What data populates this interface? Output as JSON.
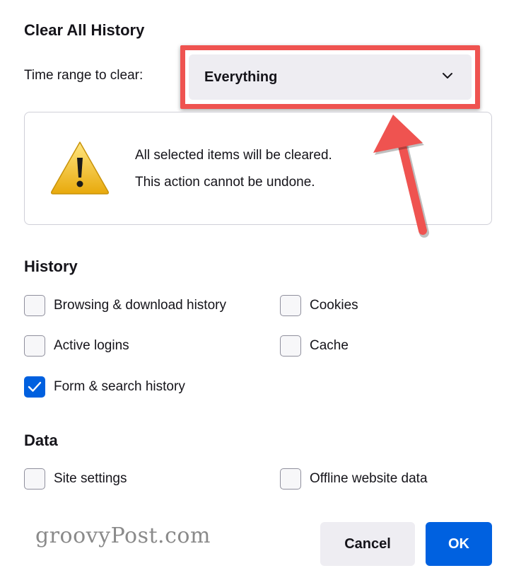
{
  "dialog": {
    "title": "Clear All History",
    "time_range": {
      "label": "Time range to clear:",
      "selected": "Everything"
    },
    "warning": {
      "line1": "All selected items will be cleared.",
      "line2": "This action cannot be undone."
    },
    "history": {
      "title": "History",
      "items": [
        {
          "label": "Browsing & download history",
          "checked": false
        },
        {
          "label": "Cookies",
          "checked": false
        },
        {
          "label": "Active logins",
          "checked": false
        },
        {
          "label": "Cache",
          "checked": false
        },
        {
          "label": "Form & search history",
          "checked": true
        }
      ]
    },
    "data": {
      "title": "Data",
      "items": [
        {
          "label": "Site settings",
          "checked": false
        },
        {
          "label": "Offline website data",
          "checked": false
        }
      ]
    },
    "buttons": {
      "cancel": "Cancel",
      "ok": "OK"
    }
  },
  "watermark": "groovyPost.com",
  "colors": {
    "accent": "#0061e0",
    "highlight": "#ef5350",
    "warning_icon": "#f5c518"
  },
  "icons": [
    "chevron-down-icon",
    "warning-icon",
    "checkmark-icon",
    "annotation-arrow-icon"
  ]
}
